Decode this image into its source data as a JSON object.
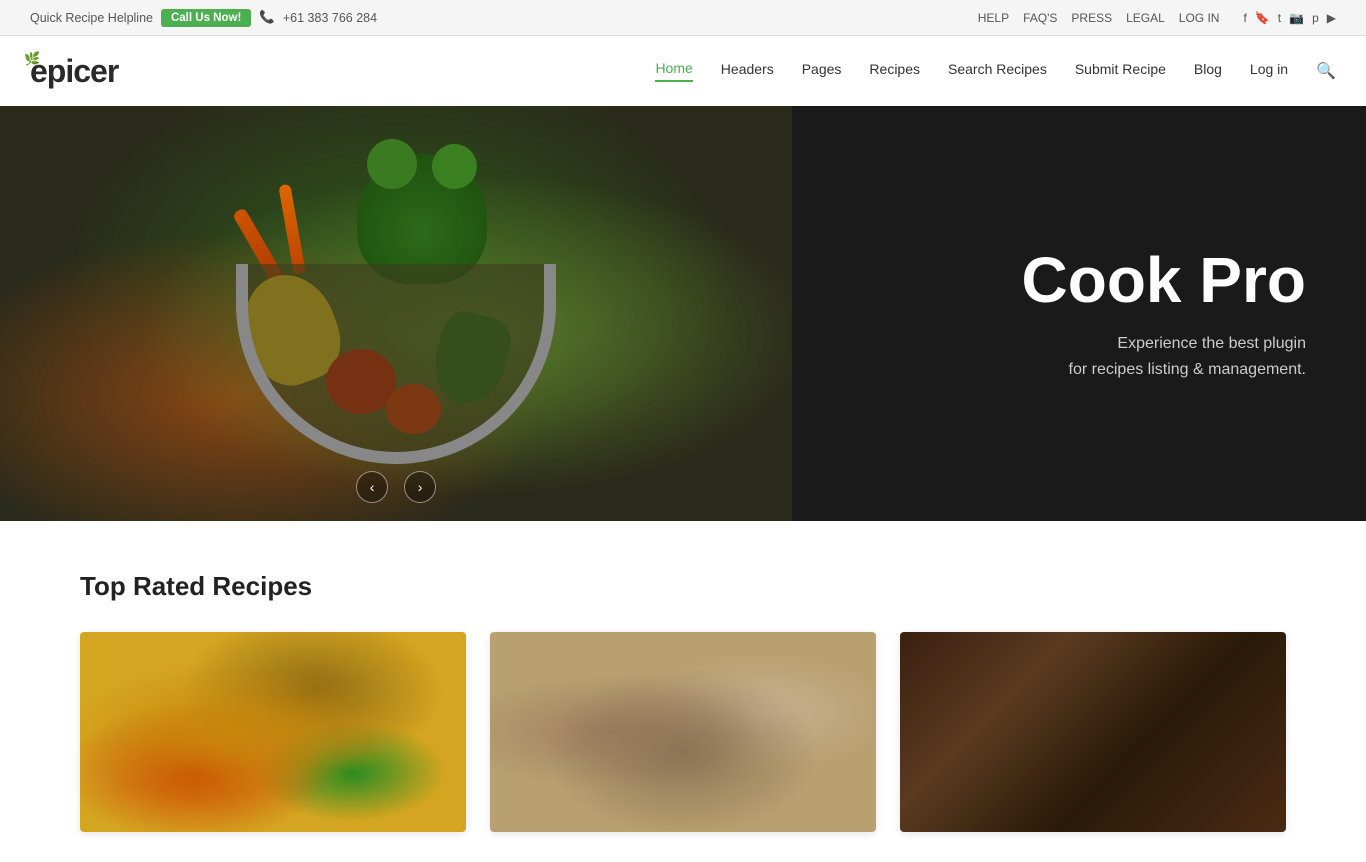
{
  "topbar": {
    "helpline_text": "Quick Recipe Helpline",
    "call_btn_label": "Call Us Now!",
    "phone_icon": "📞",
    "phone_number": "+61 383 766 284",
    "nav_links": [
      "HELP",
      "FAQ'S",
      "PRESS",
      "LEGAL",
      "LOG IN"
    ],
    "social_icons": [
      {
        "name": "facebook-icon",
        "symbol": "f"
      },
      {
        "name": "bookmark-icon",
        "symbol": "🔖"
      },
      {
        "name": "twitter-icon",
        "symbol": "t"
      },
      {
        "name": "instagram-icon",
        "symbol": "📷"
      },
      {
        "name": "pinterest-icon",
        "symbol": "p"
      },
      {
        "name": "youtube-icon",
        "symbol": "▶"
      }
    ]
  },
  "navbar": {
    "logo_text": "epicer",
    "menu_items": [
      {
        "label": "Home",
        "active": true
      },
      {
        "label": "Headers",
        "active": false
      },
      {
        "label": "Pages",
        "active": false
      },
      {
        "label": "Recipes",
        "active": false
      },
      {
        "label": "Search Recipes",
        "active": false
      },
      {
        "label": "Submit Recipe",
        "active": false
      },
      {
        "label": "Blog",
        "active": false
      },
      {
        "label": "Log in",
        "active": false
      }
    ]
  },
  "hero": {
    "title": "Cook Pro",
    "subtitle_line1": "Experience the best plugin",
    "subtitle_line2": "for recipes listing & management."
  },
  "slider": {
    "prev_label": "‹",
    "next_label": "›"
  },
  "recipes_section": {
    "title": "Top Rated Recipes",
    "cards": [
      {
        "id": "pizza",
        "alt": "Pizza with vegetables"
      },
      {
        "id": "mushroom",
        "alt": "Mushroom dish"
      },
      {
        "id": "darkwood",
        "alt": "Recipe on dark wood background"
      }
    ]
  }
}
